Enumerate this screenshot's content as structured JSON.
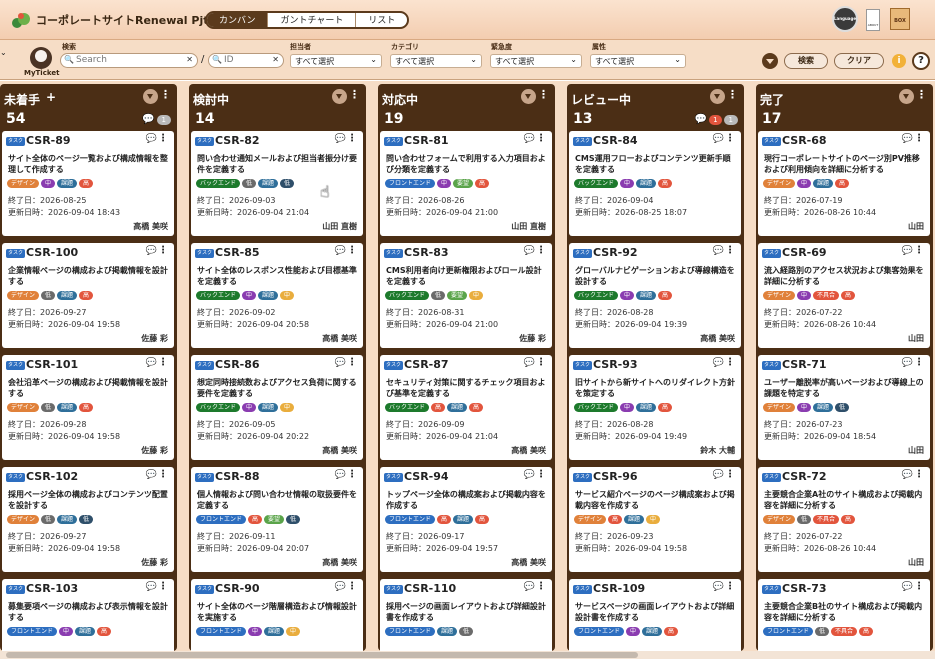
{
  "app": {
    "title": "コーポレートサイトRenewal Pjt"
  },
  "views": [
    "カンバン",
    "ガントチャート",
    "リスト"
  ],
  "header_icons": {
    "language": "Language",
    "mid": "ABOUT",
    "box": "BOX"
  },
  "filters": {
    "my_ticket": "MyTicket",
    "search_label": "検索",
    "search_placeholder": "Search",
    "sep": "/",
    "id_placeholder": "ID",
    "owner_label": "担当者",
    "category_label": "カテゴリ",
    "urgency_label": "緊急度",
    "attr_label": "属性",
    "select_all": "すべて選択",
    "search_button": "検索",
    "clear_button": "クリア"
  },
  "colors": {
    "header_bg": "#f3cdb0",
    "column_bg": "#4b2e15",
    "frontend": "#2d6ec0",
    "backend": "#1d7a2c",
    "design": "#e0813a",
    "low": "#6b6b6b",
    "mid": "#8a3cb0",
    "task": "#2f6f9a",
    "high": "#e2553d",
    "attr": "#e9ad3d",
    "bug": "#e2553d"
  },
  "columns": [
    {
      "title": "未着手",
      "plus": "+",
      "count": "54",
      "badges": {
        "red": "",
        "gray": "1"
      },
      "cards": [
        {
          "id": "CSR-89",
          "text": "サイト全体のページ一覧および構成情報を整理して作成する",
          "tags": [
            "デザイン",
            "中",
            "課題",
            "高"
          ],
          "start": "終了日：2026-08-25",
          "updated": "更新日時：2026-09-04 18:43",
          "assignee": "高橋 美咲",
          "red": true
        },
        {
          "id": "CSR-100",
          "text": "企業情報ページの構成および掲載情報を設計する",
          "tags": [
            "デザイン",
            "低",
            "課題",
            "高"
          ],
          "start": "終了日：2026-09-27",
          "updated": "更新日時：2026-09-04 19:58",
          "assignee": "佐藤 彩"
        },
        {
          "id": "CSR-101",
          "text": "会社沿革ページの構成および掲載情報を設計する",
          "tags": [
            "デザイン",
            "低",
            "課題",
            "高"
          ],
          "start": "終了日：2026-09-28",
          "updated": "更新日時：2026-09-04 19:58",
          "assignee": "佐藤 彩"
        },
        {
          "id": "CSR-102",
          "text": "採用ページ全体の構成およびコンテンツ配置を設計する",
          "tags": [
            "デザイン",
            "低",
            "課題",
            "低"
          ],
          "start": "終了日：2026-09-27",
          "updated": "更新日時：2026-09-04 19:58",
          "assignee": "佐藤 彩"
        },
        {
          "id": "CSR-103",
          "text": "募集要項ページの構成および表示情報を設計する",
          "tags": [
            "フロントエンド",
            "中",
            "課題",
            "高"
          ],
          "start": "",
          "updated": "",
          "assignee": ""
        }
      ]
    },
    {
      "title": "検討中",
      "count": "14",
      "badges": {
        "red": "",
        "gray": ""
      },
      "cards": [
        {
          "id": "CSR-82",
          "text": "問い合わせ通知メールおよび担当者振分け要件を定義する",
          "tags": [
            "バックエンド",
            "低",
            "課題",
            "低"
          ],
          "start": "終了日：2026-09-03",
          "updated": "更新日時：2026-09-04 21:04",
          "assignee": "山田 直樹"
        },
        {
          "id": "CSR-85",
          "text": "サイト全体のレスポンス性能および目標基準を定義する",
          "tags": [
            "バックエンド",
            "中",
            "課題",
            "中"
          ],
          "start": "終了日：2026-09-02",
          "updated": "更新日時：2026-09-04 20:58",
          "assignee": "高橋 美咲"
        },
        {
          "id": "CSR-86",
          "text": "想定同時接続数およびアクセス負荷に関する要件を定義する",
          "tags": [
            "バックエンド",
            "中",
            "課題",
            "中"
          ],
          "start": "終了日：2026-09-05",
          "updated": "更新日時：2026-09-04 20:22",
          "assignee": "高橋 美咲"
        },
        {
          "id": "CSR-88",
          "text": "個人情報および問い合わせ情報の取扱要件を定義する",
          "tags": [
            "フロントエンド",
            "高",
            "要望",
            "低"
          ],
          "start": "終了日：2026-09-11",
          "updated": "更新日時：2026-09-04 20:07",
          "assignee": "高橋 美咲"
        },
        {
          "id": "CSR-90",
          "text": "サイト全体のページ階層構造および情報設計を実施する",
          "tags": [
            "フロントエンド",
            "中",
            "課題",
            "中"
          ],
          "start": "",
          "updated": "",
          "assignee": ""
        }
      ]
    },
    {
      "title": "対応中",
      "count": "19",
      "badges": {
        "red": "",
        "gray": ""
      },
      "cards": [
        {
          "id": "CSR-81",
          "text": "問い合わせフォームで利用する入力項目および分類を定義する",
          "tags": [
            "フロントエンド",
            "中",
            "要望",
            "高"
          ],
          "start": "終了日：2026-08-26",
          "updated": "更新日時：2026-09-04 21:00",
          "assignee": "山田 直樹"
        },
        {
          "id": "CSR-83",
          "text": "CMS利用者向け更新権限およびロール設計を定義する",
          "tags": [
            "バックエンド",
            "低",
            "要望",
            "中"
          ],
          "start": "終了日：2026-08-31",
          "updated": "更新日時：2026-09-04 21:00",
          "assignee": "佐藤 彩"
        },
        {
          "id": "CSR-87",
          "text": "セキュリティ対策に関するチェック項目および基準を定義する",
          "tags": [
            "バックエンド",
            "高",
            "課題",
            "高"
          ],
          "start": "終了日：2026-09-09",
          "updated": "更新日時：2026-09-04 21:04",
          "assignee": "高橋 美咲"
        },
        {
          "id": "CSR-94",
          "text": "トップページ全体の構成案および掲載内容を作成する",
          "tags": [
            "フロントエンド",
            "高",
            "課題",
            "高"
          ],
          "start": "終了日：2026-09-17",
          "updated": "更新日時：2026-09-04 19:57",
          "assignee": "高橋 美咲"
        },
        {
          "id": "CSR-110",
          "text": "採用ページの画面レイアウトおよび詳細設計書を作成する",
          "tags": [
            "フロントエンド",
            "課題",
            "低"
          ],
          "start": "",
          "updated": "",
          "assignee": ""
        }
      ]
    },
    {
      "title": "レビュー中",
      "count": "13",
      "badges": {
        "red": "1",
        "gray": "1"
      },
      "cards": [
        {
          "id": "CSR-84",
          "text": "CMS運用フローおよびコンテンツ更新手順を定義する",
          "tags": [
            "バックエンド",
            "中",
            "課題",
            "高"
          ],
          "start": "終了日：2026-09-04",
          "updated": "更新日時：2026-08-25 18:07",
          "assignee": ""
        },
        {
          "id": "CSR-92",
          "text": "グローバルナビゲーションおよび導線構造を設計する",
          "tags": [
            "バックエンド",
            "中",
            "課題",
            "高"
          ],
          "start": "終了日：2026-08-28",
          "updated": "更新日時：2026-09-04 19:39",
          "assignee": "高橋 美咲",
          "red": true
        },
        {
          "id": "CSR-93",
          "text": "旧サイトから新サイトへのリダイレクト方針を策定する",
          "tags": [
            "バックエンド",
            "中",
            "課題",
            "高"
          ],
          "start": "終了日：2026-08-28",
          "updated": "更新日時：2026-09-04 19:49",
          "assignee": "鈴木 大輔"
        },
        {
          "id": "CSR-96",
          "text": "サービス紹介ページのページ構成案および掲載内容を作成する",
          "tags": [
            "デザイン",
            "高",
            "課題",
            "中"
          ],
          "start": "終了日：2026-09-23",
          "updated": "更新日時：2026-09-04 19:58",
          "assignee": ""
        },
        {
          "id": "CSR-109",
          "text": "サービスページの画面レイアウトおよび詳細設計書を作成する",
          "tags": [
            "フロントエンド",
            "中",
            "課題",
            "高"
          ],
          "start": "",
          "updated": "",
          "assignee": ""
        }
      ]
    },
    {
      "title": "完了",
      "count": "17",
      "badges": {
        "red": "",
        "gray": ""
      },
      "cards": [
        {
          "id": "CSR-68",
          "text": "現行コーポレートサイトのページ別PV推移および利用傾向を詳細に分析する",
          "tags": [
            "デザイン",
            "中",
            "課題",
            "高"
          ],
          "start": "終了日：2026-07-19",
          "updated": "更新日時：2026-08-26 10:44",
          "assignee": "山田"
        },
        {
          "id": "CSR-69",
          "text": "流入経路別のアクセス状況および集客効果を詳細に分析する",
          "tags": [
            "デザイン",
            "中",
            "不具合",
            "高"
          ],
          "start": "終了日：2026-07-22",
          "updated": "更新日時：2026-08-26 10:44",
          "assignee": "山田"
        },
        {
          "id": "CSR-71",
          "text": "ユーザー離脱率が高いページおよび導線上の課題を特定する",
          "tags": [
            "デザイン",
            "中",
            "課題",
            "低"
          ],
          "start": "終了日：2026-07-23",
          "updated": "更新日時：2026-09-04 18:54",
          "assignee": "山田"
        },
        {
          "id": "CSR-72",
          "text": "主要競合企業A社のサイト構成および掲載内容を詳細に分析する",
          "tags": [
            "デザイン",
            "低",
            "不具合",
            "高"
          ],
          "start": "終了日：2026-07-22",
          "updated": "更新日時：2026-08-26 10:44",
          "assignee": "山田"
        },
        {
          "id": "CSR-73",
          "text": "主要競合企業B社のサイト構成および掲載内容を詳細に分析する",
          "tags": [
            "フロントエンド",
            "低",
            "不具合",
            "高"
          ],
          "start": "",
          "updated": "",
          "assignee": ""
        }
      ]
    }
  ]
}
